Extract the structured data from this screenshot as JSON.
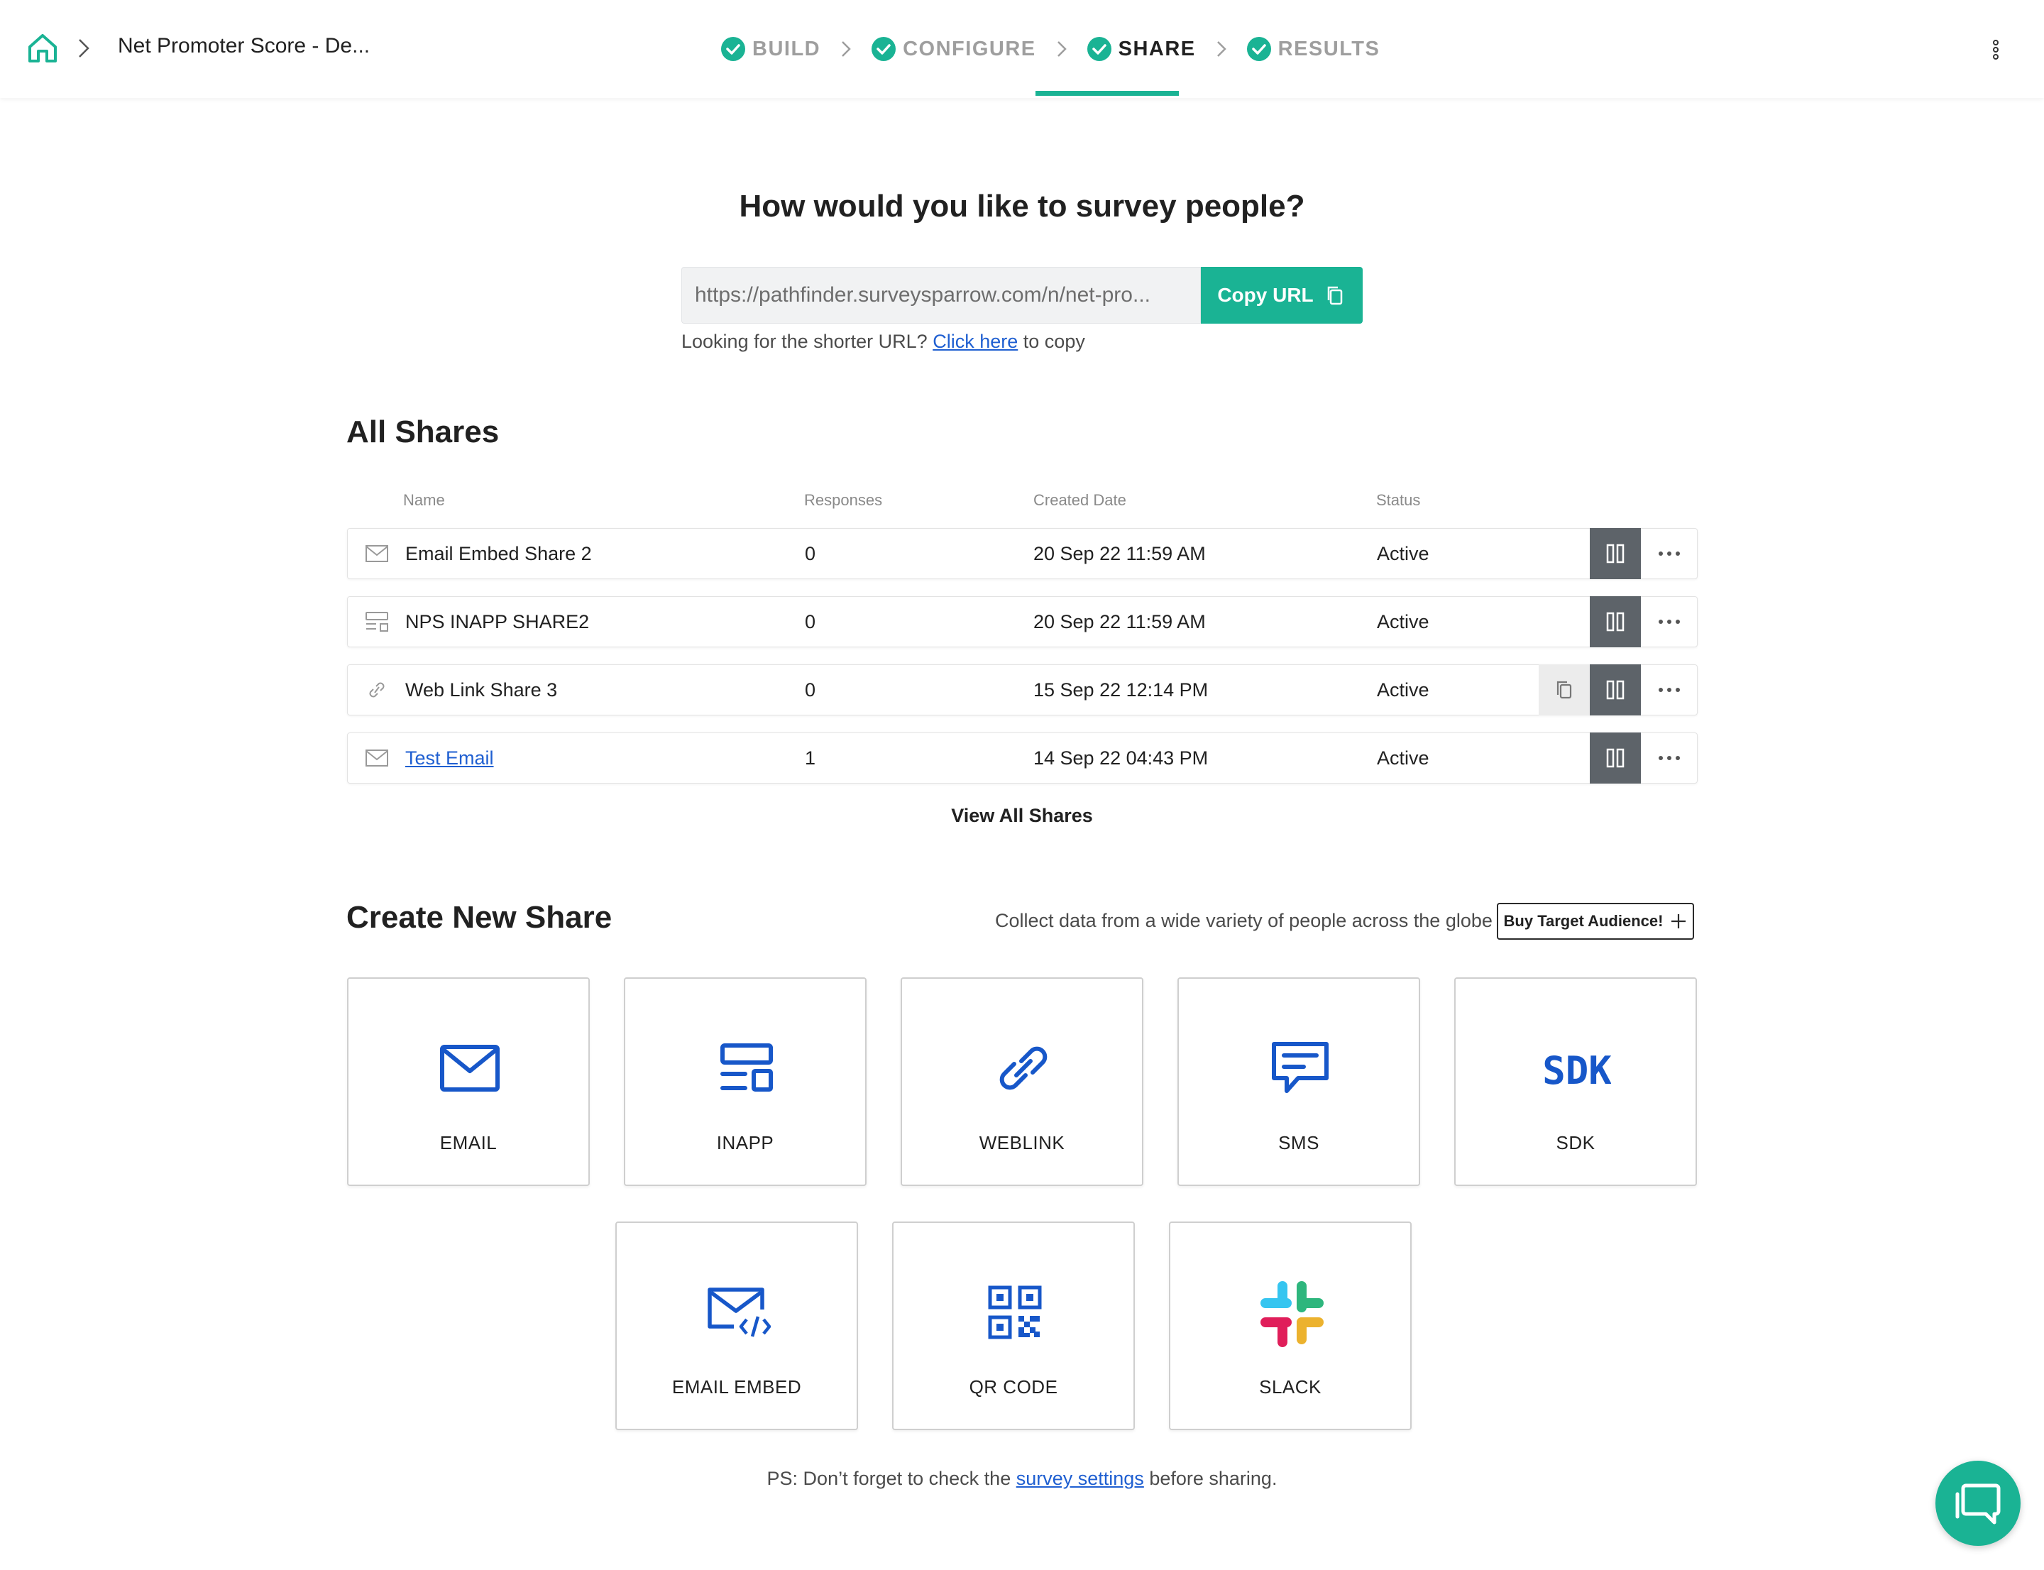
{
  "header": {
    "survey_name": "Net Promoter Score - De...",
    "steps": [
      {
        "label": "BUILD"
      },
      {
        "label": "CONFIGURE"
      },
      {
        "label": "SHARE"
      },
      {
        "label": "RESULTS"
      }
    ],
    "active_step": "SHARE"
  },
  "intro": {
    "question": "How would you like to survey people?",
    "url_value": "https://pathfinder.surveysparrow.com/n/net-pro...",
    "copy_button": "Copy URL",
    "shorter_prefix": "Looking for the shorter URL?",
    "shorter_link": "Click here",
    "shorter_suffix": "to copy"
  },
  "all_shares": {
    "title": "All Shares",
    "columns": {
      "name": "Name",
      "responses": "Responses",
      "created": "Created Date",
      "status": "Status"
    },
    "rows": [
      {
        "icon": "email-icon",
        "name": "Email Embed Share 2",
        "responses": "0",
        "created": "20 Sep 22 11:59 AM",
        "status": "Active"
      },
      {
        "icon": "inapp-icon",
        "name": "NPS INAPP SHARE2",
        "responses": "0",
        "created": "20 Sep 22 11:59 AM",
        "status": "Active"
      },
      {
        "icon": "link-icon",
        "name": "Web Link Share 3",
        "responses": "0",
        "created": "15 Sep 22 12:14 PM",
        "status": "Active"
      },
      {
        "icon": "email-icon",
        "name": "Test Email",
        "responses": "1",
        "created": "14 Sep 22 04:43 PM",
        "status": "Active"
      }
    ],
    "view_all": "View All Shares"
  },
  "create_share": {
    "title": "Create New Share",
    "collect_text": "Collect data from a wide variety of people across the globe",
    "buy_button": "Buy Target Audience!",
    "cards": [
      {
        "label": "EMAIL",
        "icon": "email-icon"
      },
      {
        "label": "INAPP",
        "icon": "inapp-icon"
      },
      {
        "label": "WEBLINK",
        "icon": "link-icon"
      },
      {
        "label": "SMS",
        "icon": "sms-icon"
      },
      {
        "label": "SDK",
        "icon": "sdk-icon",
        "icon_text": "SDK"
      },
      {
        "label": "EMAIL EMBED",
        "icon": "email-embed-icon"
      },
      {
        "label": "QR CODE",
        "icon": "qr-code-icon"
      },
      {
        "label": "SLACK",
        "icon": "slack-icon"
      }
    ]
  },
  "footer": {
    "ps_prefix": "PS: Don’t forget to check the",
    "ps_link": "survey settings",
    "ps_suffix": "before sharing."
  },
  "colors": {
    "accent": "#1ab394",
    "link": "#1f5fd1",
    "icon_blue": "#1757c9",
    "pause_bg": "#5d6369"
  }
}
